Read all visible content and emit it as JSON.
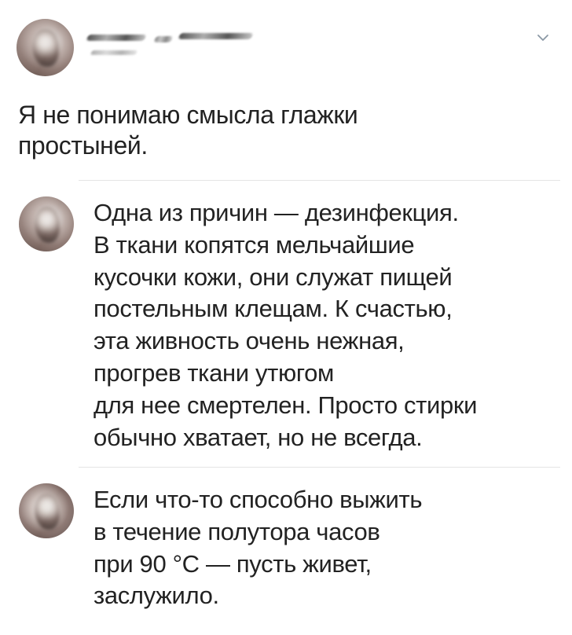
{
  "post": {
    "text_lines": [
      "Я не понимаю смысла глажки",
      "простыней."
    ]
  },
  "replies": [
    {
      "text_lines": [
        "Одна из причин — дезинфекция.",
        "В ткани копятся мельчайшие",
        "кусочки кожи, они служат пищей",
        "постельным клещам. К счастью,",
        "эта живность очень нежная,",
        "прогрев ткани утюгом",
        "для нее смертелен. Просто стирки",
        "обычно хватает, но не всегда."
      ]
    },
    {
      "text_lines": [
        "Если что-то способно выжить",
        "в течение полутора часов",
        "при 90 °С — пусть живет,",
        "заслужило."
      ]
    }
  ],
  "icons": {
    "menu": "chevron-down-icon",
    "avatar": "avatar"
  },
  "colors": {
    "background": "#ffffff",
    "text": "#222222",
    "divider": "#e4e4e4",
    "chevron": "#8b98a5"
  }
}
